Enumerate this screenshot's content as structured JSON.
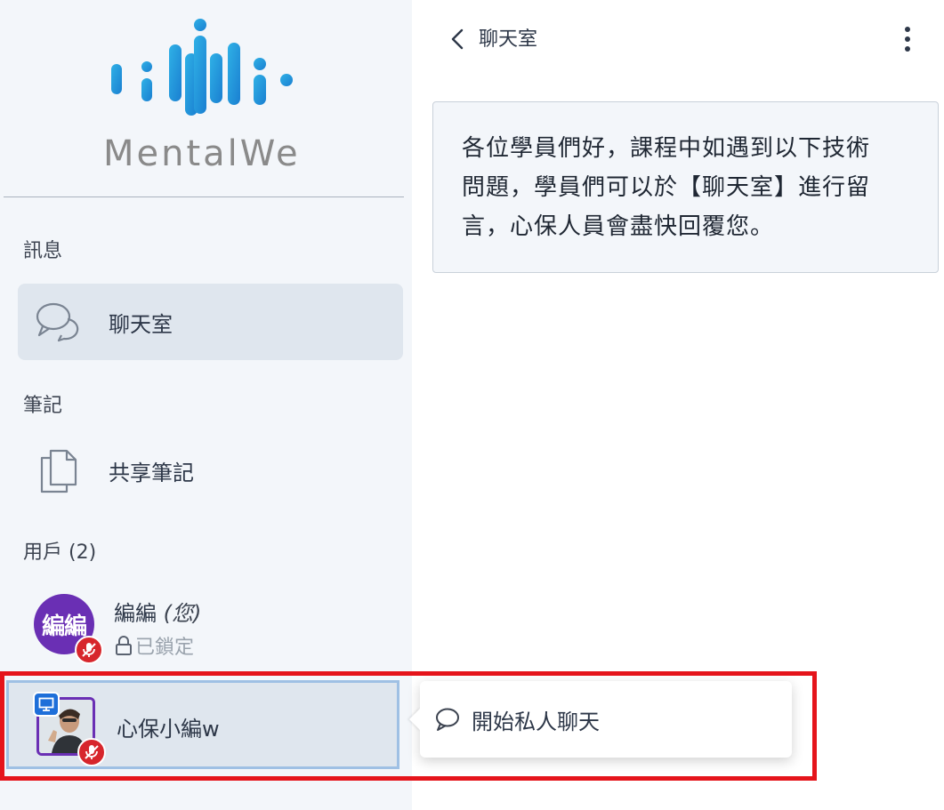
{
  "logo": {
    "text": "MentalWe",
    "icon": "mentalwe-logo"
  },
  "sidebar": {
    "sections": {
      "messages": "訊息",
      "notes": "筆記",
      "users": "用戶 (2)"
    },
    "chat_item": {
      "label": "聊天室",
      "icon": "chat-bubbles-icon"
    },
    "notes_item": {
      "label": "共享筆記",
      "icon": "documents-icon"
    },
    "users": [
      {
        "avatar_text": "編編",
        "name": "編編",
        "suffix": "(您)",
        "status": "已鎖定",
        "avatar_color": "#6a2fb4",
        "mic": "muted"
      },
      {
        "name": "心保小編w",
        "avatar": "photo",
        "role": "presenter",
        "mic": "muted"
      }
    ]
  },
  "popover": {
    "label": "開始私人聊天",
    "icon": "chat-icon"
  },
  "chat": {
    "title": "聊天室",
    "welcome_lines": [
      "各位學員們好，課程中如遇到以下技術",
      "問題，學員們可以於【聊天室】進行留",
      "言，心保人員會盡快回覆您。"
    ]
  },
  "colors": {
    "accent_purple": "#6a2fb4",
    "mic_red": "#d7262c",
    "highlight_red": "#e5141b",
    "presenter_blue": "#1e6fd9",
    "sidebar_bg": "#f3f6fa"
  }
}
